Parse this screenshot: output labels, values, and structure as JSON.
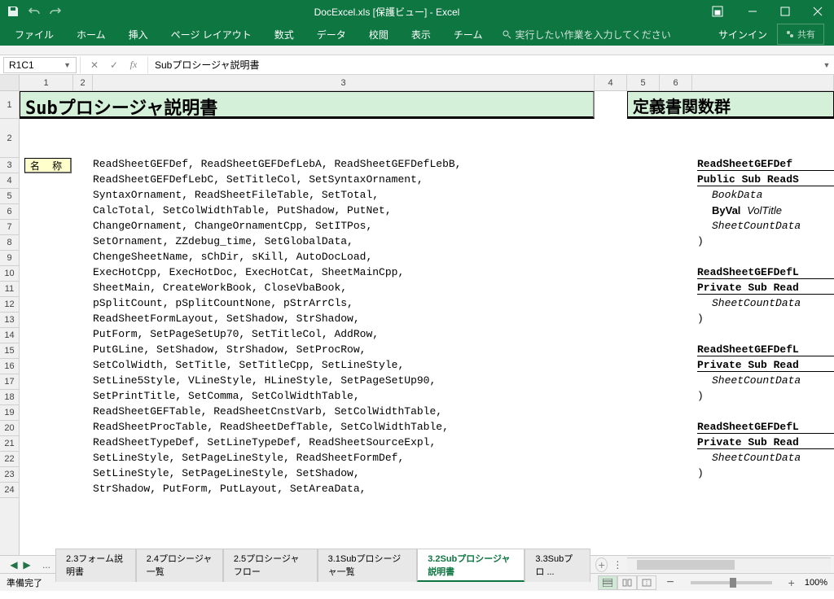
{
  "titlebar": {
    "title": "DocExcel.xls [保護ビュー] - Excel"
  },
  "ribbon": {
    "tabs": [
      "ファイル",
      "ホーム",
      "挿入",
      "ページ レイアウト",
      "数式",
      "データ",
      "校閲",
      "表示",
      "チーム"
    ],
    "tell_me": "実行したい作業を入力してください",
    "signin": "サインイン",
    "share": "共有"
  },
  "namebox": "R1C1",
  "formula": "Subプロシージャ説明書",
  "col_headers": [
    "1",
    "2",
    "3",
    "4",
    "5",
    "6"
  ],
  "row_headers": [
    "1",
    "2",
    "3",
    "4",
    "5",
    "6",
    "7",
    "8",
    "9",
    "10",
    "11",
    "12",
    "13",
    "14",
    "15",
    "16",
    "17",
    "18",
    "19",
    "20",
    "21",
    "22",
    "23",
    "24"
  ],
  "cells": {
    "title1": "Subプロシージャ説明書",
    "title2": "定義書関数群",
    "label": "名 称",
    "code": [
      "ReadSheetGEFDef, ReadSheetGEFDefLebA, ReadSheetGEFDefLebB,",
      "ReadSheetGEFDefLebC, SetTitleCol, SetSyntaxOrnament,",
      "SyntaxOrnament, ReadSheetFileTable, SetTotal,",
      "CalcTotal, SetColWidthTable, PutShadow, PutNet,",
      "ChangeOrnament, ChangeOrnamentCpp, SetITPos,",
      "SetOrnament, ZZdebug_time, SetGlobalData,",
      "ChengeSheetName, sChDir, sKill, AutoDocLoad,",
      "ExecHotCpp, ExecHotDoc, ExecHotCat, SheetMainCpp,",
      "SheetMain, CreateWorkBook, CloseVbaBook,",
      "pSplitCount, pSplitCountNone, pStrArrCls,",
      "ReadSheetFormLayout, SetShadow, StrShadow,",
      "PutForm, SetPageSetUp70, SetTitleCol, AddRow,",
      "PutGLine, SetShadow, StrShadow, SetProcRow,",
      "SetColWidth, SetTitle, SetTitleCpp, SetLineStyle,",
      "SetLine5Style, VLineStyle, HLineStyle, SetPageSetUp90,",
      "SetPrintTitle, SetComma, SetColWidthTable,",
      "ReadSheetGEFTable, ReadSheetCnstVarb, SetColWidthTable,",
      "ReadSheetProcTable, ReadSheetDefTable, SetColWidthTable,",
      "ReadSheetTypeDef, SetLineTypeDef, ReadSheetSourceExpl,",
      "SetLineStyle, SetPageLineStyle, ReadSheetFormDef,",
      "SetLineStyle, SetPageLineStyle, SetShadow,",
      "StrShadow, PutForm, PutLayout, SetAreaData,"
    ],
    "right": [
      {
        "t": "ReadSheetGEFDef",
        "cls": "bold",
        "row": 3
      },
      {
        "t": "Public Sub ReadS",
        "cls": "bold",
        "row": 4
      },
      {
        "t": "BookData",
        "cls": "indent ital",
        "row": 5
      },
      {
        "t": "ByVal VolTitle",
        "cls": "indent",
        "row": 6,
        "mix": true
      },
      {
        "t": "SheetCountData",
        "cls": "indent ital",
        "row": 7
      },
      {
        "t": ")",
        "cls": "",
        "row": 8
      },
      {
        "t": "ReadSheetGEFDefL",
        "cls": "bold",
        "row": 10
      },
      {
        "t": "Private Sub Read",
        "cls": "bold",
        "row": 11
      },
      {
        "t": "SheetCountData",
        "cls": "indent ital",
        "row": 12
      },
      {
        "t": ")",
        "cls": "",
        "row": 13
      },
      {
        "t": "ReadSheetGEFDefL",
        "cls": "bold",
        "row": 15
      },
      {
        "t": "Private Sub Read",
        "cls": "bold",
        "row": 16
      },
      {
        "t": "SheetCountData",
        "cls": "indent ital",
        "row": 17
      },
      {
        "t": ")",
        "cls": "",
        "row": 18
      },
      {
        "t": "ReadSheetGEFDefL",
        "cls": "bold",
        "row": 20
      },
      {
        "t": "Private Sub Read",
        "cls": "bold",
        "row": 21
      },
      {
        "t": "SheetCountData",
        "cls": "indent ital",
        "row": 22
      },
      {
        "t": ")",
        "cls": "",
        "row": 23
      }
    ]
  },
  "tabs": {
    "ellipsis": "...",
    "items": [
      {
        "label": "2.3フォーム説明書",
        "active": false
      },
      {
        "label": "2.4プロシージャ一覧",
        "active": false
      },
      {
        "label": "2.5プロシージャフロー",
        "active": false
      },
      {
        "label": "3.1Subプロシージャ一覧",
        "active": false
      },
      {
        "label": "3.2Subプロシージャ説明書",
        "active": true
      },
      {
        "label": "3.3Subプロ ...",
        "active": false
      }
    ]
  },
  "status": {
    "ready": "準備完了",
    "zoom": "100%"
  }
}
